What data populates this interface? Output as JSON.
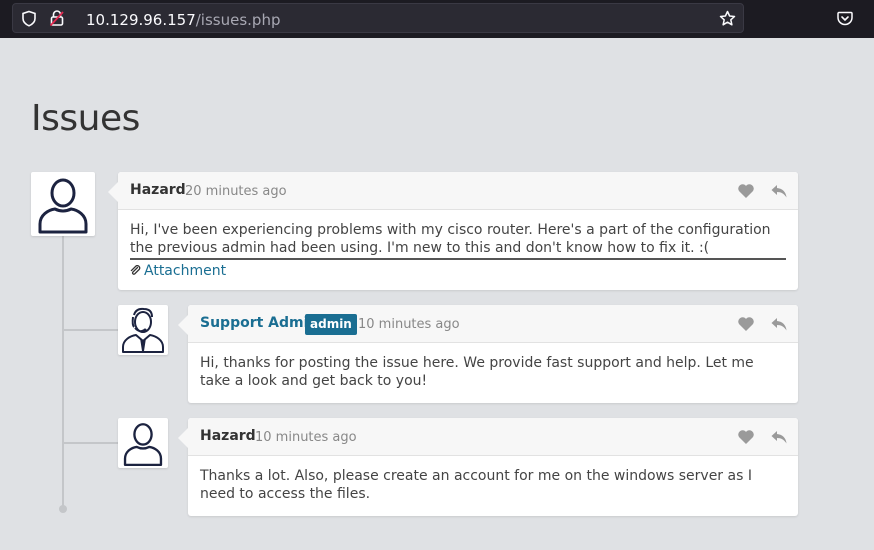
{
  "browser": {
    "url_host": "10.129.96.157",
    "url_path": "/issues.php",
    "icons": [
      "shield-icon",
      "lock-broken-icon",
      "bookmark-star-icon",
      "pocket-icon"
    ]
  },
  "page": {
    "title": "Issues"
  },
  "posts": [
    {
      "author": "Hazard",
      "time": "20 minutes ago",
      "body": "Hi, I've been experiencing problems with my cisco router. Here's a part of the configuration the previous admin had been using. I'm new to this and don't know how to fix it. :(",
      "attachment": "Attachment"
    },
    {
      "author": "Support Admin",
      "badge": "admin",
      "time": "10 minutes ago",
      "body": "Hi, thanks for posting the issue here. We provide fast support and help. Let me take a look and get back to you!"
    },
    {
      "author": "Hazard",
      "time": "10 minutes ago",
      "body": "Thanks a lot. Also, please create an account for me on the windows server as I need to access the files."
    }
  ],
  "colors": {
    "accent": "#1a6e92",
    "page_bg": "#dfe1e4",
    "browser_bg": "#1c1b22"
  }
}
